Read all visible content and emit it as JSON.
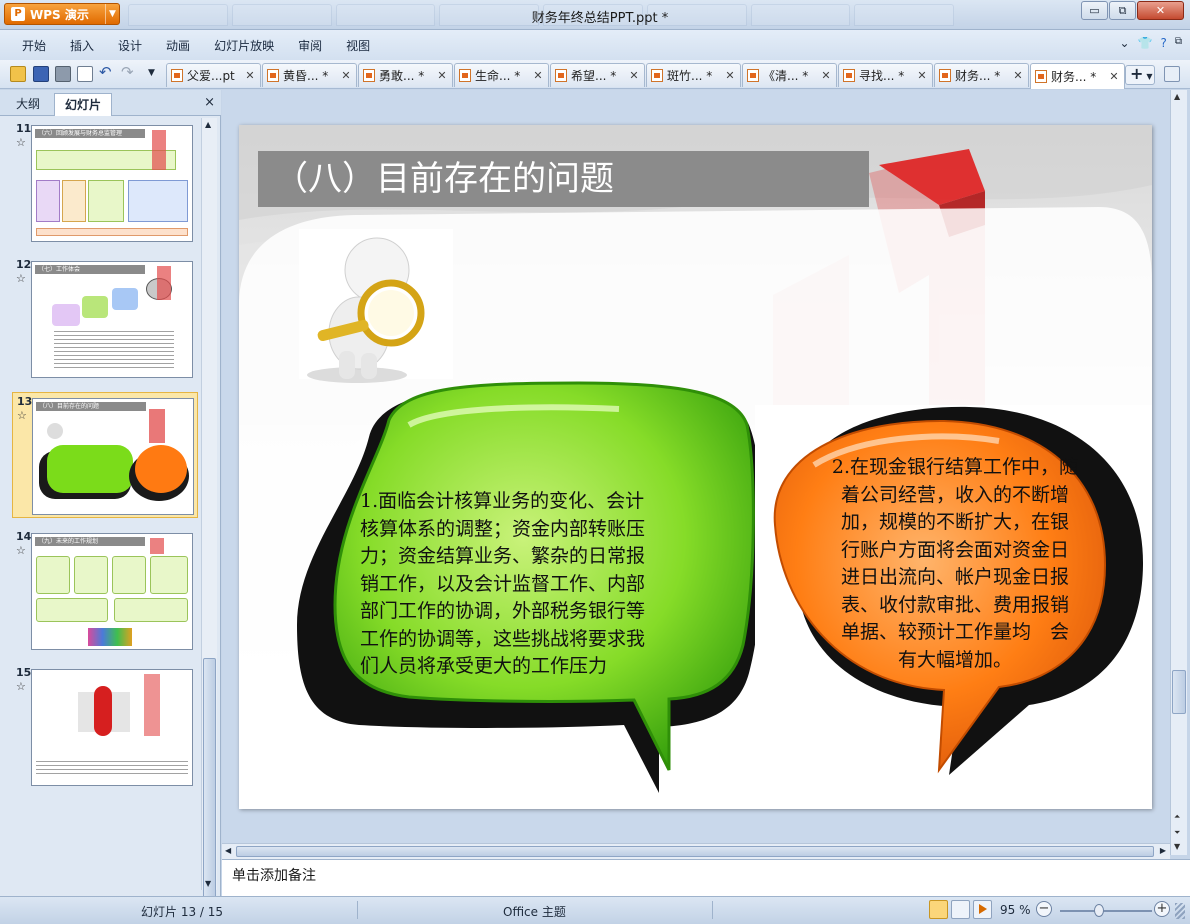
{
  "app": {
    "brand": "WPS 演示",
    "document_title": "财务年终总结PPT.ppt *"
  },
  "window_controls": {
    "minimize": "▭",
    "restore": "⧉",
    "close": "✕"
  },
  "menu": [
    "开始",
    "插入",
    "设计",
    "动画",
    "幻灯片放映",
    "审阅",
    "视图"
  ],
  "doc_tabs": [
    {
      "label": "父爱...pt"
    },
    {
      "label": "黄昏... *"
    },
    {
      "label": "勇敢... *"
    },
    {
      "label": "生命... *"
    },
    {
      "label": "希望... *"
    },
    {
      "label": "斑竹... *"
    },
    {
      "label": "《清... *"
    },
    {
      "label": "寻找... *"
    },
    {
      "label": "财务... *"
    },
    {
      "label": "财务... *",
      "active": true
    }
  ],
  "left_panel": {
    "tab_outline": "大纲",
    "tab_slides": "幻灯片",
    "close": "×"
  },
  "thumbnails": [
    {
      "number": "11",
      "title": "（六）回顾发展与财务总监管理"
    },
    {
      "number": "12",
      "title": "（七）工作体会"
    },
    {
      "number": "13",
      "title": "（八）目前存在的问题",
      "selected": true
    },
    {
      "number": "14",
      "title": "（九）未来的工作规划"
    },
    {
      "number": "15",
      "title": ""
    }
  ],
  "slide": {
    "title": "（八）目前存在的问题",
    "bubble_green_lines": [
      "1.面临会计核算业务的变化、会计",
      "核算体系的调整；资金内部转账压",
      "力；资金结算业务、繁杂的日常报",
      "销工作，以及会计监督工作、内部",
      "部门工作的协调，外部税务银行等",
      "工作的协调等，这些挑战将要求我",
      "们人员将承受更大的工作压力"
    ],
    "bubble_orange_lines": [
      "2.在现金银行结算工作中，随",
      "着公司经营，收入的不断增",
      "加，规模的不断扩大，在银",
      "行账户方面将会面对资金日",
      "进日出流向、帐户现金日报",
      "表、收付款审批、费用报销",
      "单据、较预计工作量均　会",
      "有大幅增加。"
    ],
    "colors": {
      "green": "#7bdc1a",
      "orange": "#ff7a12",
      "title_bg": "#8b8b8b",
      "deco_red": "#e23a3a"
    }
  },
  "notes_placeholder": "单击添加备注",
  "status": {
    "slide_counter": "幻灯片 13 / 15",
    "theme": "Office 主题",
    "zoom": "95 %"
  }
}
